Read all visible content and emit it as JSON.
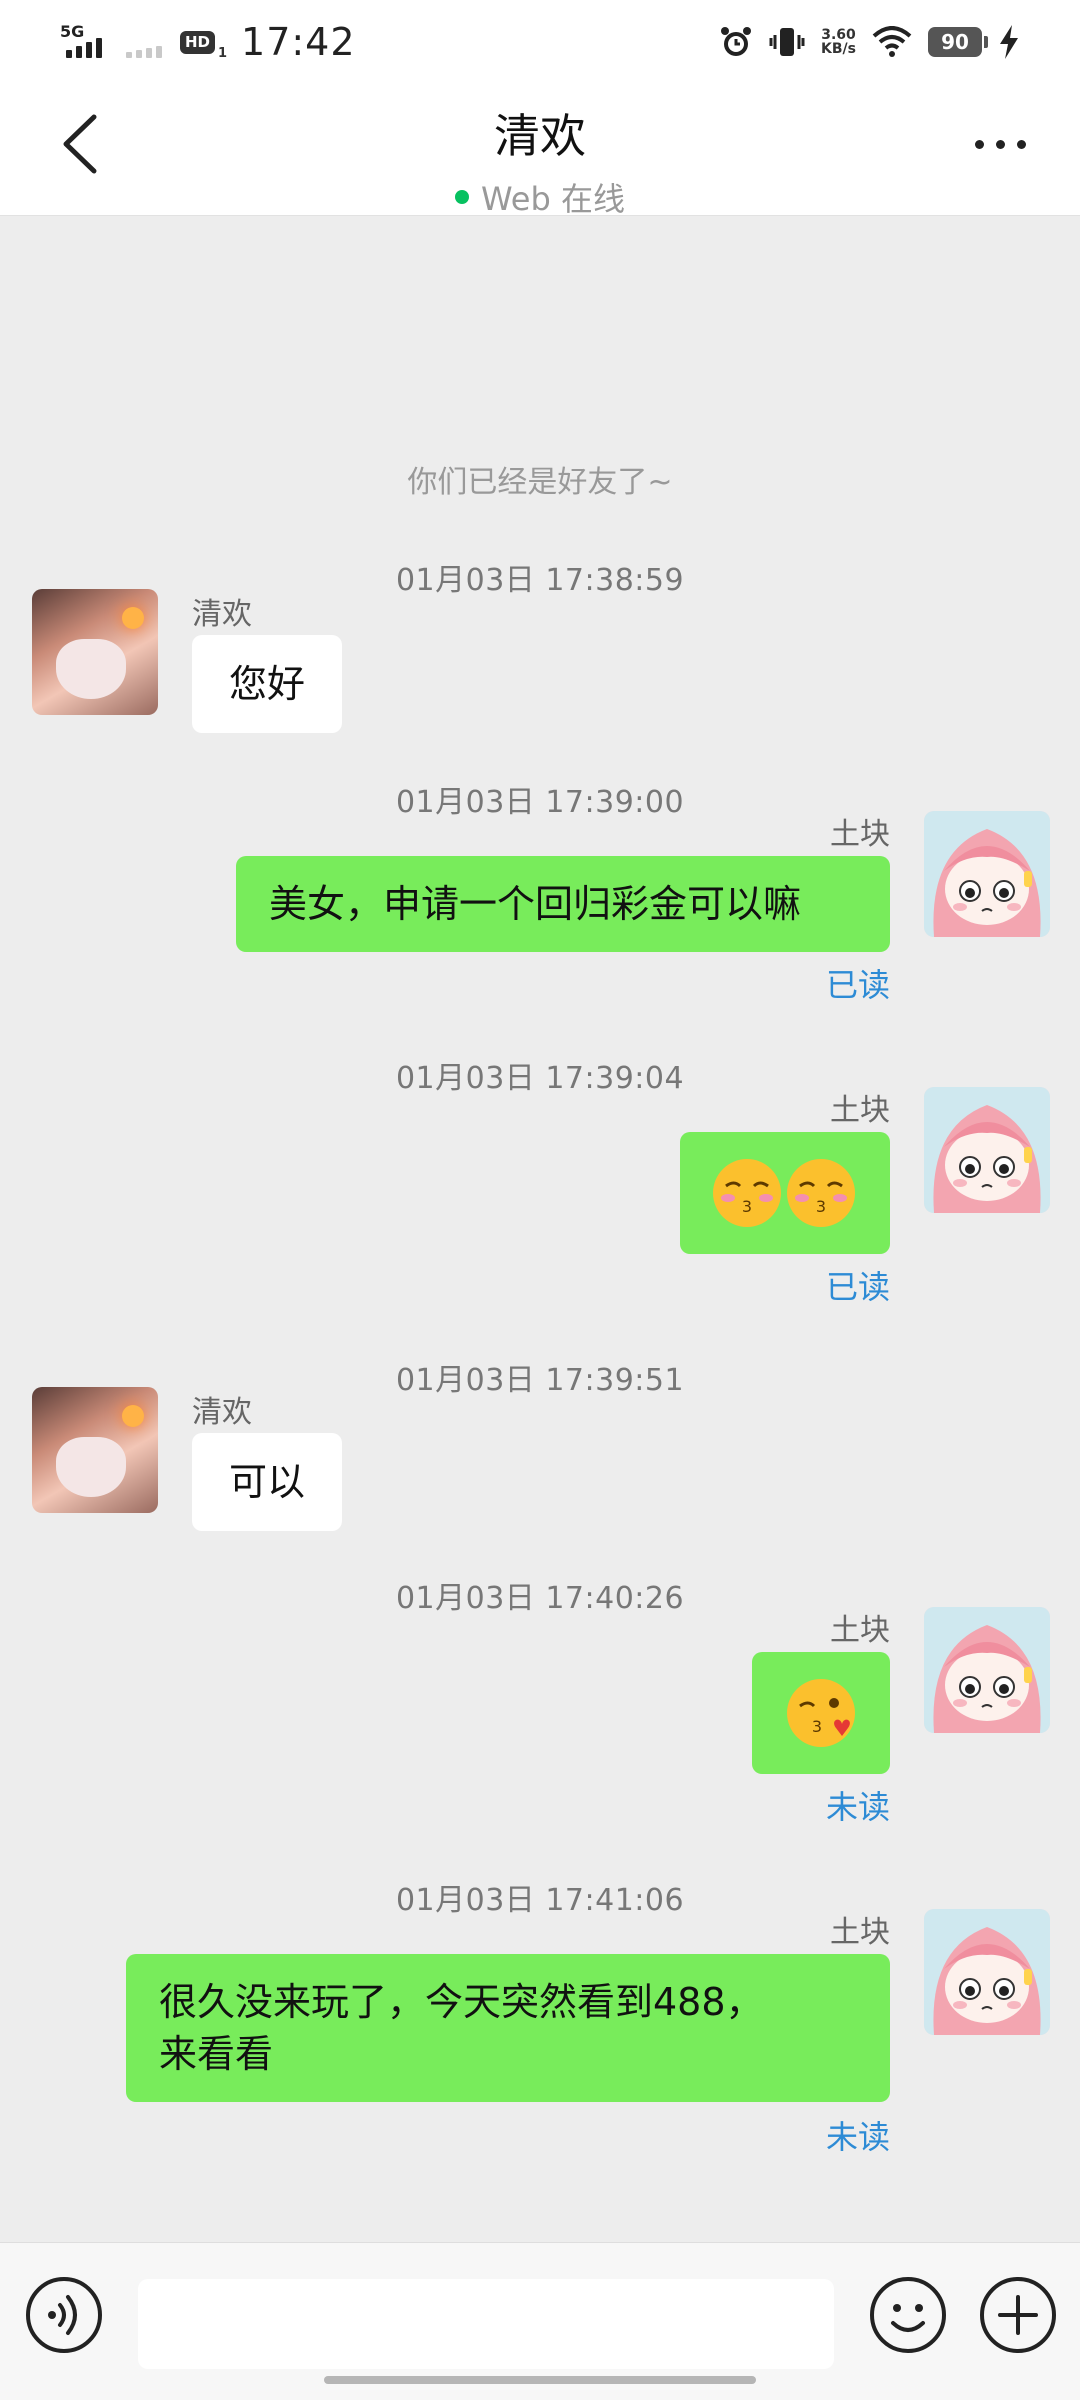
{
  "status_bar": {
    "network_label": "5G",
    "hd_label": "HD",
    "hd_sub": "1",
    "time": "17:42",
    "speed_value": "3.60",
    "speed_unit": "KB/s",
    "battery": "90",
    "icons": [
      "signal-icon",
      "alarm-icon",
      "vibrate-icon",
      "wifi-icon",
      "battery-icon",
      "charging-icon"
    ]
  },
  "header": {
    "title": "清欢",
    "subtitle": "Web 在线",
    "status_color": "#07c160",
    "icons": [
      "back-arrow-icon",
      "more-dots-icon"
    ]
  },
  "chat": {
    "system_note": "你们已经是好友了~",
    "messages": [
      {
        "time": "01月03日 17:38:59",
        "direction": "in",
        "sender": "清欢",
        "text": "您好"
      },
      {
        "time": "01月03日 17:39:00",
        "direction": "out",
        "sender": "土块",
        "text": "美女，申请一个回归彩金可以嘛",
        "status": "已读"
      },
      {
        "time": "01月03日 17:39:04",
        "direction": "out",
        "sender": "土块",
        "emoji": "kissing-closed-eyes-emoji x2",
        "status": "已读"
      },
      {
        "time": "01月03日 17:39:51",
        "direction": "in",
        "sender": "清欢",
        "text": "可以"
      },
      {
        "time": "01月03日 17:40:26",
        "direction": "out",
        "sender": "土块",
        "emoji": "face-blowing-kiss-emoji",
        "status": "未读"
      },
      {
        "time": "01月03日 17:41:06",
        "direction": "out",
        "sender": "土块",
        "text_line1": "很久没来玩了，今天突然看到488，",
        "text_line2": "来看看",
        "status": "未读"
      }
    ]
  },
  "input_bar": {
    "placeholder": "",
    "icons": [
      "voice-icon",
      "emoji-icon",
      "plus-icon"
    ]
  },
  "colors": {
    "outgoing_bubble": "#78ec5b",
    "incoming_bubble": "#ffffff",
    "chat_background": "#ededed",
    "read_status": "#2d8bd5"
  }
}
